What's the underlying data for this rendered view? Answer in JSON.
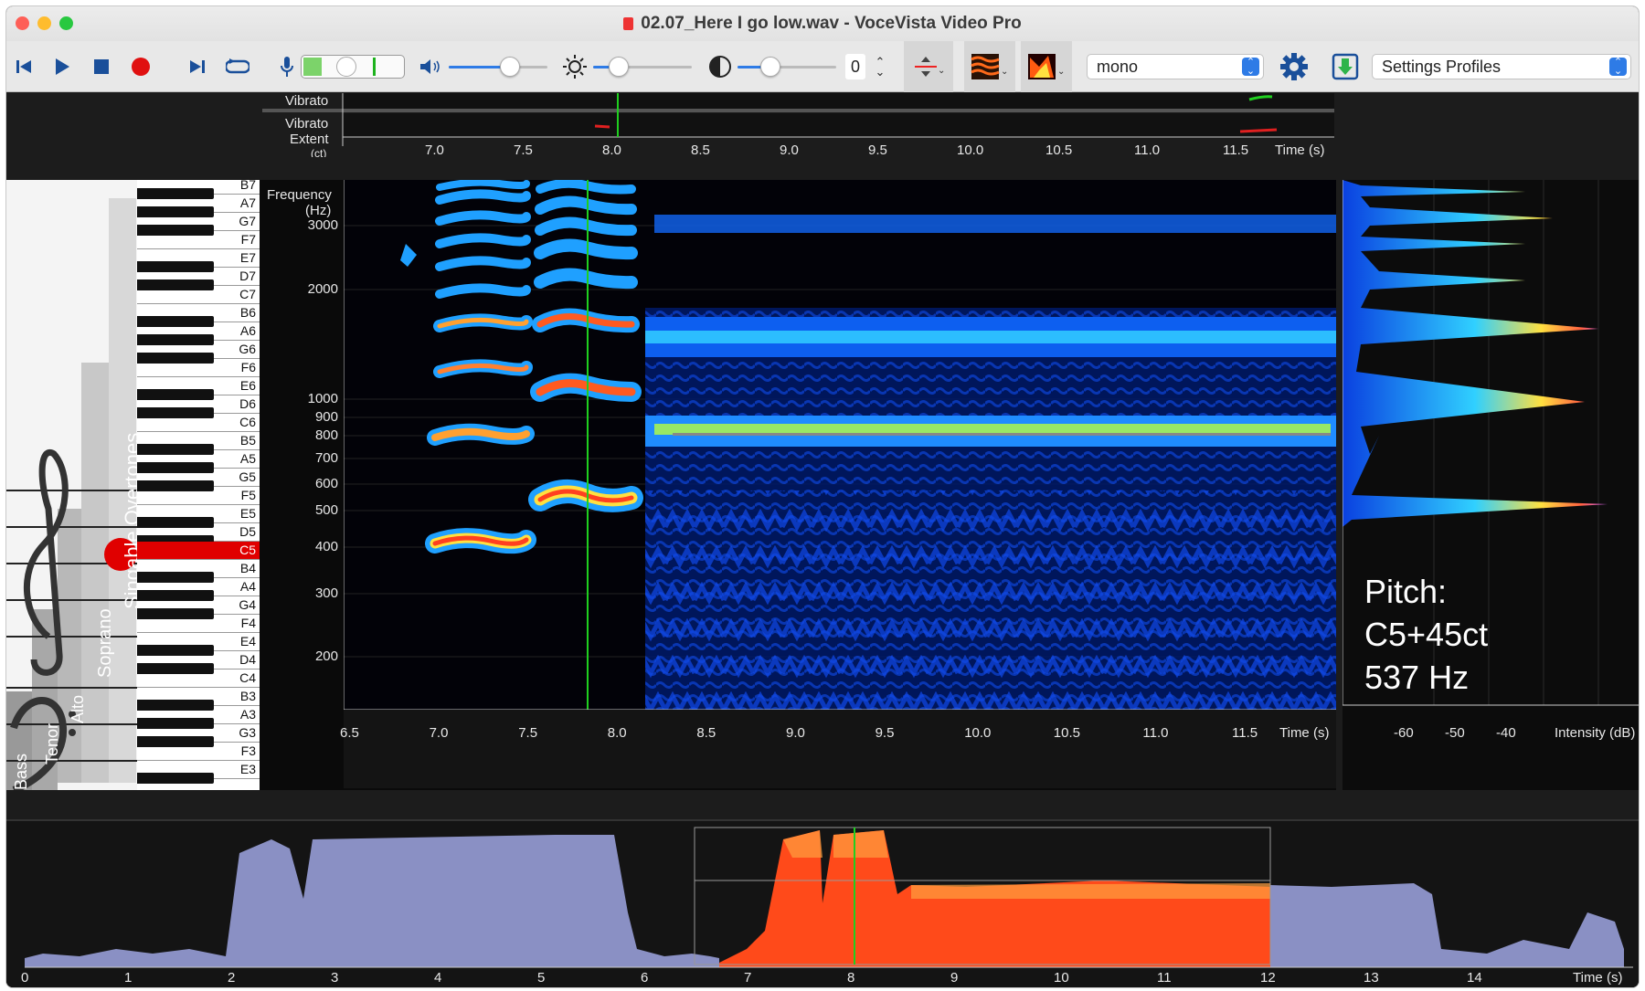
{
  "window": {
    "title": "02.07_Here I go low.wav - VoceVista Video Pro"
  },
  "toolbar": {
    "number_value": "0",
    "channel_select": "mono",
    "profiles_select": "Settings Profiles",
    "icons": [
      "skip-back-icon",
      "play-icon",
      "stop-icon",
      "record-icon",
      "skip-forward-icon",
      "loop-icon",
      "microphone-icon",
      "speaker-icon",
      "brightness-icon",
      "contrast-icon",
      "stepper-icon",
      "center-icon",
      "spectrum-color-icon",
      "spectrum-mode-icon",
      "gear-icon",
      "export-icon"
    ]
  },
  "vibrato": {
    "label_rate": "Vibrato",
    "label_extent_1": "Vibrato",
    "label_extent_2": "Extent",
    "label_extent_3": "(ct)",
    "ticks": [
      "7.0",
      "7.5",
      "8.0",
      "8.5",
      "9.0",
      "9.5",
      "10.0",
      "10.5",
      "11.0",
      "11.5"
    ],
    "time_label": "Time (s)"
  },
  "piano": {
    "keys": [
      "B7",
      "A7",
      "G7",
      "F7",
      "E7",
      "D7",
      "C7",
      "B6",
      "A6",
      "G6",
      "F6",
      "E6",
      "D6",
      "C6",
      "B5",
      "A5",
      "G5",
      "F5",
      "E5",
      "D5",
      "C5",
      "B4",
      "A4",
      "G4",
      "F4",
      "E4",
      "D4",
      "C4",
      "B3",
      "A3",
      "G3",
      "F3",
      "E3"
    ],
    "highlight": "C5",
    "vertical_texts": [
      "Singable Overtones",
      "Soprano",
      "Alto",
      "Tenor",
      "Bass"
    ]
  },
  "spectrogram": {
    "y_title_1": "Frequency",
    "y_title_2": "(Hz)",
    "y_ticks": [
      "3000",
      "2000",
      "1000",
      "900",
      "800",
      "700",
      "600",
      "500",
      "400",
      "300",
      "200"
    ],
    "x_ticks": [
      "6.5",
      "7.0",
      "7.5",
      "8.0",
      "8.5",
      "9.0",
      "9.5",
      "10.0",
      "10.5",
      "11.0",
      "11.5"
    ],
    "x_label": "Time (s)"
  },
  "side_spectrum": {
    "pitch_label": "Pitch:",
    "pitch_note": "C5+45ct",
    "pitch_hz": "537 Hz",
    "x_ticks": [
      "-60",
      "-50",
      "-40"
    ],
    "x_label": "Intensity (dB)"
  },
  "overview": {
    "x_ticks": [
      "0",
      "1",
      "2",
      "3",
      "4",
      "5",
      "6",
      "7",
      "8",
      "9",
      "10",
      "11",
      "12",
      "13",
      "14"
    ],
    "x_label": "Time (s)"
  },
  "colors": {
    "accent_blue": "#2e7be6",
    "waveform": "#8a90c4",
    "selection": "#ff4a1a",
    "cursor": "#22bb22",
    "highlight_key": "#e00000"
  }
}
